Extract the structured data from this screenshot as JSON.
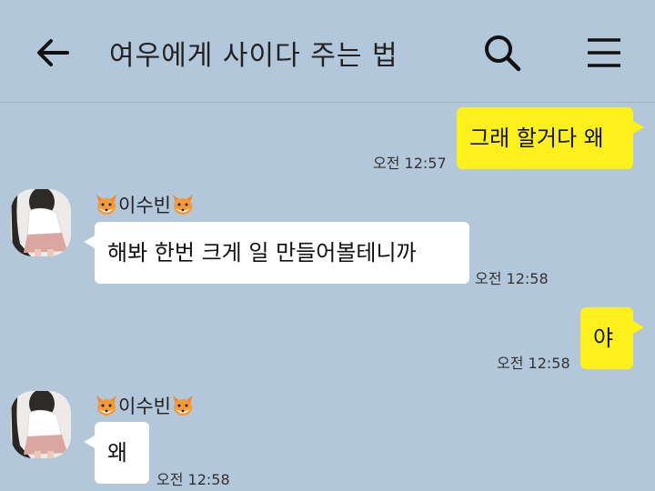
{
  "header": {
    "title": "여우에게 사이다 주는 법",
    "back_icon": "arrow-left-icon",
    "search_icon": "search-icon",
    "menu_icon": "hamburger-menu-icon"
  },
  "messages": [
    {
      "side": "mine",
      "text": "그래 할거다 왜",
      "time": "오전 12:57"
    },
    {
      "side": "theirs",
      "sender": "이수빈",
      "text": "해봐 한번 크게 일 만들어볼테니까",
      "time": "오전 12:58"
    },
    {
      "side": "mine",
      "text": "야",
      "time": "오전 12:58"
    },
    {
      "side": "theirs",
      "sender": "이수빈",
      "text": "왜",
      "time": "오전 12:58"
    }
  ],
  "colors": {
    "background": "#b2c7da",
    "my_bubble": "#fef01b",
    "their_bubble": "#ffffff"
  }
}
